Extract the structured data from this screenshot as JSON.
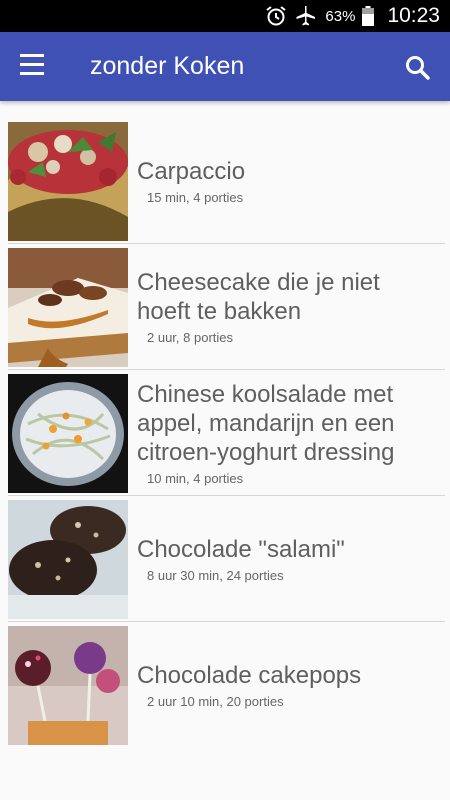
{
  "status_bar": {
    "battery_percent": "63%",
    "time": "10:23",
    "icons": [
      "alarm-icon",
      "airplane-icon",
      "battery-icon"
    ]
  },
  "app_bar": {
    "title": "zonder Koken",
    "menu_icon": "hamburger-menu-icon",
    "search_icon": "search-icon",
    "background": "#3f51b5"
  },
  "recipes": [
    {
      "title": "Carpaccio",
      "meta": "15 min, 4 porties"
    },
    {
      "title": "Cheesecake die je niet hoeft te bakken",
      "meta": "2 uur, 8 porties"
    },
    {
      "title": "Chinese koolsalade met appel, mandarijn en een citroen-yoghurt dressing",
      "meta": "10 min, 4 porties"
    },
    {
      "title": "Chocolade \"salami\"",
      "meta": "8 uur 30 min, 24 porties"
    },
    {
      "title": "Chocolade cakepops",
      "meta": "2 uur 10 min, 20 porties"
    }
  ]
}
